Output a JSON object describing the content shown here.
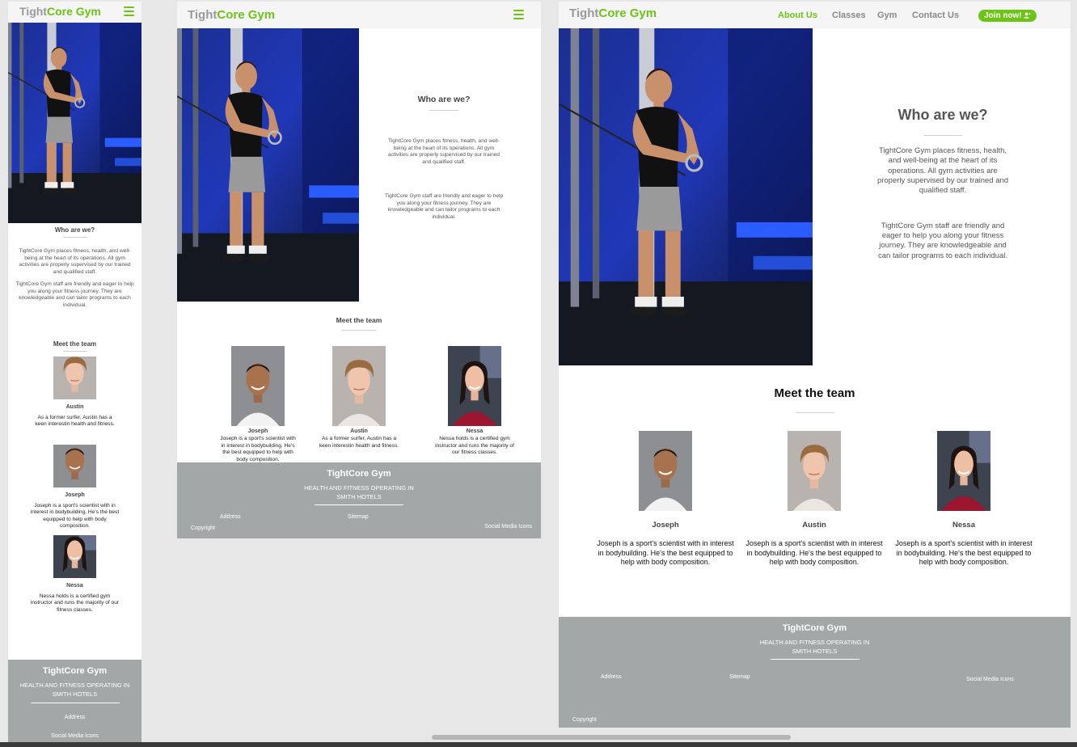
{
  "brand": {
    "part1": "Tight",
    "part2": "Core Gym",
    "footer_title": "TightCore Gym",
    "footer_slogan": "HEALTH AND FITNESS OPERATING IN SMITH HOTELS"
  },
  "nav": {
    "links": [
      "About Us",
      "Classes",
      "Gym",
      "Contact Us"
    ],
    "cta": "Join now!",
    "active": "About Us"
  },
  "about": {
    "heading": "Who are we?",
    "para1": "TightCore Gym places fitness, health, and well-being at the heart of its operations. All gym activities are properly supervised by our trained and qualified staff.",
    "para2": "TightCore Gym staff are friendly and eager to help you along your fitness journey. They are knowledgeable and can tailor programs to each individual."
  },
  "team": {
    "heading": "Meet the team",
    "members": [
      {
        "name": "Austin",
        "bio": "As a former surfer, Austin has a keen interestin health and fitness."
      },
      {
        "name": "Joseph",
        "bio": "Joseph is a sport's scientist with in interest in bodybuilding. He's the best equipped to help with body composition."
      },
      {
        "name": "Nessa",
        "bio": "Nessa holds is a certified gym instructor and runs the majority of our fitness classes."
      }
    ],
    "desktop_bio": "Joseph is a sport's scientist with in interest in bodybuilding. He's the best equipped to help with body composition."
  },
  "footer": {
    "address": "Address",
    "sitemap": "Sitemap",
    "social": "Social Media Icons",
    "copyright": "Copyright"
  },
  "colors": {
    "brand_green": "#6cc417",
    "footer_grey": "#a4a7a8",
    "logo_grey": "#9a9a9a"
  },
  "icons": {
    "menu": "hamburger-icon",
    "join": "add-user-icon"
  }
}
